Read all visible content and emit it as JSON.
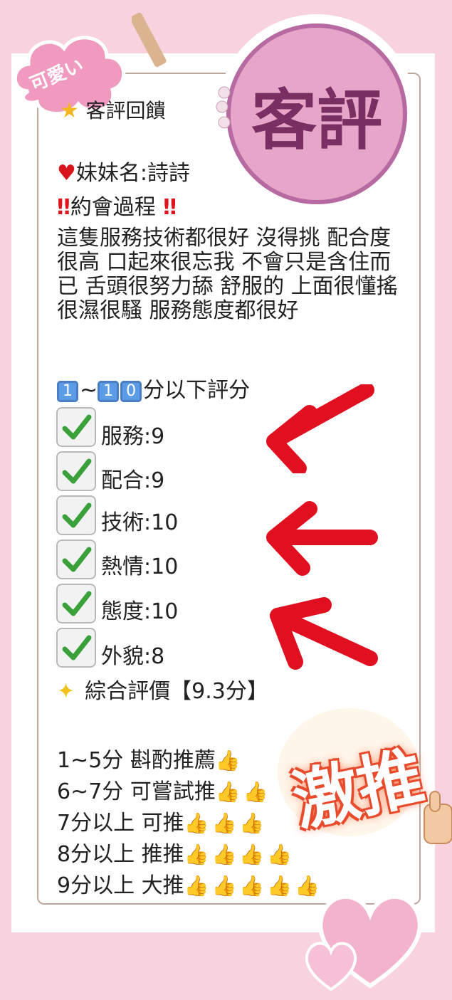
{
  "badge": {
    "title": "客評"
  },
  "tag": {
    "label": "可愛い"
  },
  "header": {
    "title": "客評回饋"
  },
  "profile": {
    "name_line": "妹妹名:詩詩",
    "section_heading": "約會過程"
  },
  "review": {
    "text": "這隻服務技術都很好 沒得挑 配合度很高 口起來很忘我 不會只是含住而已 舌頭很努力舔 舒服的 上面很懂搖 很濕很騷 服務態度都很好"
  },
  "scoring": {
    "scale_prefix_a": "1",
    "scale_sep": "~",
    "scale_prefix_b": "1",
    "scale_prefix_c": "0",
    "scale_label": "分以下評分",
    "items": [
      {
        "label": "服務:9"
      },
      {
        "label": "配合:9"
      },
      {
        "label": "技術:10"
      },
      {
        "label": "熱情:10"
      },
      {
        "label": "態度:10"
      },
      {
        "label": "外貌:8"
      }
    ],
    "overall": "綜合評價【9.3分】"
  },
  "legend": [
    {
      "label": "1~5分 斟酌推薦",
      "thumbs": "👍"
    },
    {
      "label": "6~7分 可嘗試推",
      "thumbs": "👍👍"
    },
    {
      "label": "7分以上 可推",
      "thumbs": "👍👍👍"
    },
    {
      "label": "8分以上 推推",
      "thumbs": "👍👍👍👍"
    },
    {
      "label": "9分以上 大推",
      "thumbs": "👍👍👍👍👍"
    }
  ],
  "stamp": {
    "text": "激推"
  },
  "colors": {
    "background": "#f8d3df",
    "badge_ring": "#b76aa1",
    "badge_text": "#7a2f62",
    "arrow": "#e01020",
    "check": "#3aa13a"
  }
}
